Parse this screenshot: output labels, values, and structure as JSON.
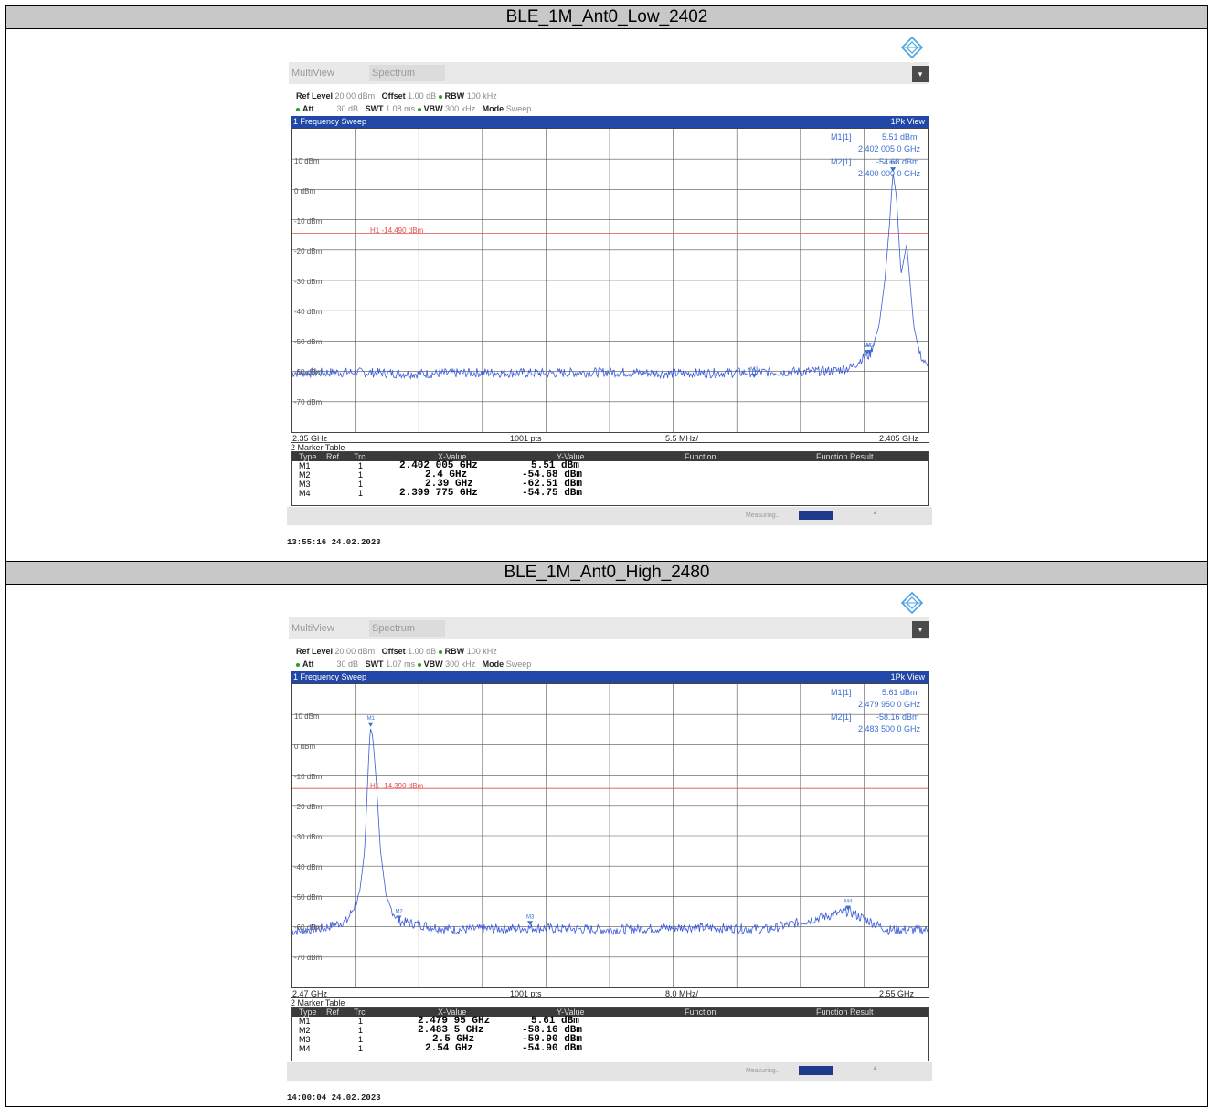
{
  "captures": [
    {
      "header": "BLE_1M_Ant0_Low_2402",
      "tab_multiview": "MultiView",
      "tab_spectrum": "Spectrum",
      "settings": {
        "ref_level_label": "Ref Level",
        "ref_level": "20.00 dBm",
        "offset_label": "Offset",
        "offset": "1.00 dB",
        "rbw_label": "RBW",
        "rbw": "100 kHz",
        "att_label": "Att",
        "att": "30 dB",
        "swt_label": "SWT",
        "swt": "1.08 ms",
        "vbw_label": "VBW",
        "vbw": "300 kHz",
        "mode_label": "Mode",
        "mode": "Sweep"
      },
      "window_title": "1 Frequency Sweep",
      "view_label": "1Pk View",
      "marker_readout": {
        "m1_label": "M1[1]",
        "m1_level": "5.51 dBm",
        "m1_freq": "2.402 005 0 GHz",
        "m2_label": "M2[1]",
        "m2_level": "-54.68 dBm",
        "m2_freq": "2.400 000 0 GHz"
      },
      "limit_line_label": "H1 -14.490 dBm",
      "x_start": "2.35 GHz",
      "points": "1001 pts",
      "span_div": "5.5 MHz/",
      "x_stop": "2.405 GHz",
      "marker_table_title": "2 Marker Table",
      "marker_table_headers": [
        "Type",
        "Ref",
        "Trc",
        "X-Value",
        "Y-Value",
        "Function",
        "Function Result"
      ],
      "marker_table_rows": [
        {
          "type": "M1",
          "trc": "1",
          "x": "2.402 005 GHz",
          "y": "5.51 dBm"
        },
        {
          "type": "M2",
          "trc": "1",
          "x": "2.4 GHz",
          "y": "-54.68 dBm"
        },
        {
          "type": "M3",
          "trc": "1",
          "x": "2.39 GHz",
          "y": "-62.51 dBm"
        },
        {
          "type": "M4",
          "trc": "1",
          "x": "2.399 775 GHz",
          "y": "-54.75 dBm"
        }
      ],
      "status_text": "Measuring...",
      "timestamp": "13:55:16  24.02.2023"
    },
    {
      "header": "BLE_1M_Ant0_High_2480",
      "tab_multiview": "MultiView",
      "tab_spectrum": "Spectrum",
      "settings": {
        "ref_level_label": "Ref Level",
        "ref_level": "20.00 dBm",
        "offset_label": "Offset",
        "offset": "1.00 dB",
        "rbw_label": "RBW",
        "rbw": "100 kHz",
        "att_label": "Att",
        "att": "30 dB",
        "swt_label": "SWT",
        "swt": "1.07 ms",
        "vbw_label": "VBW",
        "vbw": "300 kHz",
        "mode_label": "Mode",
        "mode": "Sweep"
      },
      "window_title": "1 Frequency Sweep",
      "view_label": "1Pk View",
      "marker_readout": {
        "m1_label": "M1[1]",
        "m1_level": "5.61 dBm",
        "m1_freq": "2.479 950 0 GHz",
        "m2_label": "M2[1]",
        "m2_level": "-58.16 dBm",
        "m2_freq": "2.483 500 0 GHz"
      },
      "limit_line_label": "H1 -14.390 dBm",
      "x_start": "2.47 GHz",
      "points": "1001 pts",
      "span_div": "8.0 MHz/",
      "x_stop": "2.55 GHz",
      "marker_table_title": "2 Marker Table",
      "marker_table_headers": [
        "Type",
        "Ref",
        "Trc",
        "X-Value",
        "Y-Value",
        "Function",
        "Function Result"
      ],
      "marker_table_rows": [
        {
          "type": "M1",
          "trc": "1",
          "x": "2.479 95 GHz",
          "y": "5.61 dBm"
        },
        {
          "type": "M2",
          "trc": "1",
          "x": "2.483 5 GHz",
          "y": "-58.16 dBm"
        },
        {
          "type": "M3",
          "trc": "1",
          "x": "2.5 GHz",
          "y": "-59.90 dBm"
        },
        {
          "type": "M4",
          "trc": "1",
          "x": "2.54 GHz",
          "y": "-54.90 dBm"
        }
      ],
      "status_text": "Measuring...",
      "timestamp": "14:00:04  24.02.2023"
    }
  ],
  "colors": {
    "trace": "#3b5bdb",
    "limit": "#e05050",
    "marker": "#3b6fd0",
    "titlebar": "#2147a8"
  },
  "chart_data": [
    {
      "type": "line",
      "xlabel": "",
      "ylabel": "",
      "xlim": [
        2.35,
        2.405
      ],
      "ylim": [
        -80,
        20
      ],
      "y_ticks": [
        "10 dBm",
        "0 dBm",
        "-10 dBm",
        "-20 dBm",
        "-30 dBm",
        "-40 dBm",
        "-50 dBm",
        "-60 dBm",
        "-70 dBm"
      ],
      "grid": true,
      "limit_line": -14.49,
      "noise_floor": -60.5,
      "series": [
        {
          "x": [
            2.35,
            2.3555,
            2.361,
            2.3665,
            2.372,
            2.3775,
            2.383,
            2.3885,
            2.394,
            2.397,
            2.3985,
            2.3995,
            2.4,
            2.4008,
            2.4013,
            2.4017,
            2.402,
            2.4023,
            2.4027,
            2.4032,
            2.4038,
            2.4043,
            2.405
          ],
          "y": [
            -60.5,
            -60.3,
            -60.8,
            -60.4,
            -60.6,
            -60.2,
            -60.7,
            -60.4,
            -60.1,
            -59.8,
            -58.5,
            -55.2,
            -54.7,
            -45,
            -30,
            -12,
            5.5,
            -2,
            -28,
            -18,
            -45,
            -54,
            -59
          ]
        }
      ],
      "markers": [
        {
          "name": "M1",
          "x": 2.402005,
          "y": 5.51
        },
        {
          "name": "M2",
          "x": 2.4,
          "y": -54.68
        },
        {
          "name": "M3",
          "x": 2.39,
          "y": -62.51
        },
        {
          "name": "M4",
          "x": 2.399775,
          "y": -54.75
        }
      ]
    },
    {
      "type": "line",
      "xlabel": "",
      "ylabel": "",
      "xlim": [
        2.47,
        2.55
      ],
      "ylim": [
        -80,
        20
      ],
      "y_ticks": [
        "10 dBm",
        "0 dBm",
        "-10 dBm",
        "-20 dBm",
        "-30 dBm",
        "-40 dBm",
        "-50 dBm",
        "-60 dBm",
        "-70 dBm"
      ],
      "grid": true,
      "limit_line": -14.39,
      "noise_floor": -61,
      "series": [
        {
          "x": [
            2.47,
            2.474,
            2.477,
            2.4785,
            2.4792,
            2.4797,
            2.4799,
            2.4802,
            2.4806,
            2.4812,
            2.482,
            2.4835,
            2.49,
            2.5,
            2.51,
            2.52,
            2.53,
            2.54,
            2.545,
            2.55
          ],
          "y": [
            -61.5,
            -60.5,
            -58,
            -50,
            -35,
            -5,
            5.6,
            3,
            -10,
            -35,
            -52,
            -58.2,
            -61,
            -60.4,
            -61,
            -60.2,
            -60.8,
            -54.9,
            -61,
            -61
          ]
        }
      ],
      "markers": [
        {
          "name": "M1",
          "x": 2.47995,
          "y": 5.61
        },
        {
          "name": "M2",
          "x": 2.4835,
          "y": -58.16
        },
        {
          "name": "M3",
          "x": 2.5,
          "y": -59.9
        },
        {
          "name": "M4",
          "x": 2.54,
          "y": -54.9
        }
      ]
    }
  ]
}
